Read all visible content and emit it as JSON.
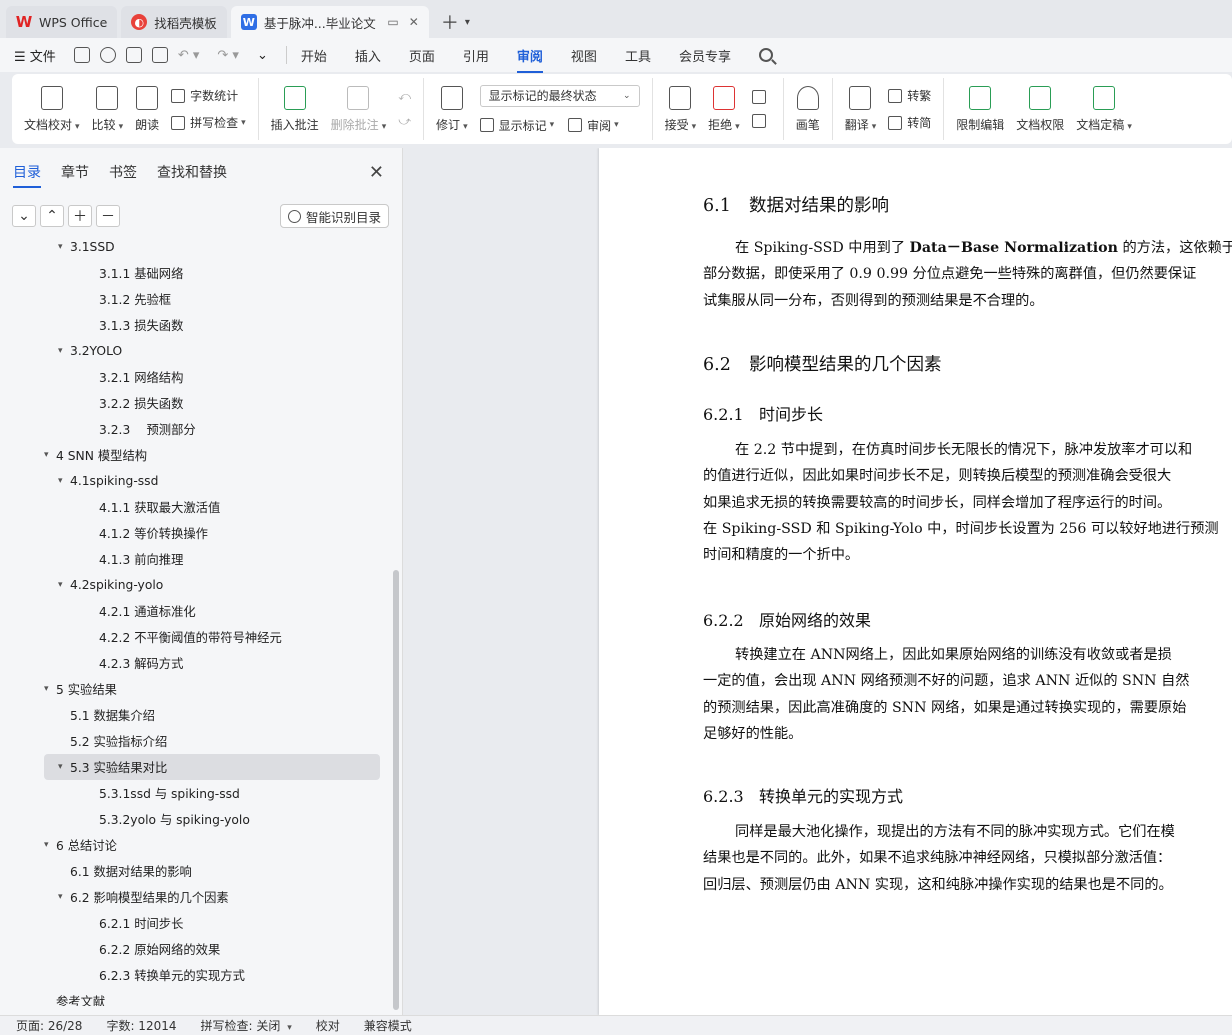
{
  "tabs": [
    {
      "label": "WPS Office",
      "icon": "wps-logo-icon"
    },
    {
      "label": "找稻壳模板",
      "icon": "daoke-logo-icon"
    },
    {
      "label": "基于脉冲...毕业论文",
      "icon": "writer-logo-icon",
      "active": true
    }
  ],
  "menu": {
    "file": "文件",
    "tabs": [
      "开始",
      "插入",
      "页面",
      "引用",
      "审阅",
      "视图",
      "工具",
      "会员专享"
    ],
    "selected": "审阅"
  },
  "ribbon": {
    "doc_check": "文档校对",
    "compare": "比较",
    "read_aloud": "朗读",
    "word_count": "字数统计",
    "spell_check": "拼写检查",
    "insert_comment": "插入批注",
    "delete_comment": "删除批注",
    "track_changes": "修订",
    "markup_state": "显示标记的最终状态",
    "show_markup": "显示标记",
    "review": "审阅",
    "accept": "接受",
    "reject": "拒绝",
    "pen": "画笔",
    "translate": "翻译",
    "to_traditional": "转繁",
    "to_simplified": "转简",
    "restrict_edit": "限制编辑",
    "doc_permission": "文档权限",
    "doc_finalize": "文档定稿"
  },
  "sidebar": {
    "tabs": [
      "目录",
      "章节",
      "书签",
      "查找和替换"
    ],
    "active_tab": "目录",
    "smart_toc": "智能识别目录",
    "toc": [
      {
        "label": "3.1SSD",
        "level": 1,
        "arrow": "down"
      },
      {
        "label": "3.1.1 基础网络",
        "level": 2
      },
      {
        "label": "3.1.2 先验框",
        "level": 2
      },
      {
        "label": "3.1.3 损失函数",
        "level": 2
      },
      {
        "label": "3.2YOLO",
        "level": 1,
        "arrow": "down"
      },
      {
        "label": "3.2.1 网络结构",
        "level": 2
      },
      {
        "label": "3.2.2 损失函数",
        "level": 2
      },
      {
        "label": "3.2.3　 预测部分",
        "level": 2
      },
      {
        "label": "4 SNN 模型结构",
        "level": 0,
        "arrow": "down"
      },
      {
        "label": "4.1spiking-ssd",
        "level": 1,
        "arrow": "down"
      },
      {
        "label": "4.1.1 获取最大激活值",
        "level": 2
      },
      {
        "label": "4.1.2 等价转换操作",
        "level": 2
      },
      {
        "label": "4.1.3 前向推理",
        "level": 2
      },
      {
        "label": "4.2spiking-yolo",
        "level": 1,
        "arrow": "down"
      },
      {
        "label": "4.2.1 通道标准化",
        "level": 2
      },
      {
        "label": "4.2.2 不平衡阈值的带符号神经元",
        "level": 2
      },
      {
        "label": "4.2.3 解码方式",
        "level": 2
      },
      {
        "label": "5 实验结果",
        "level": 0,
        "arrow": "down"
      },
      {
        "label": "5.1 数据集介绍",
        "level": 1
      },
      {
        "label": "5.2 实验指标介绍",
        "level": 1
      },
      {
        "label": "5.3 实验结果对比",
        "level": 1,
        "arrow": "down",
        "selected": true
      },
      {
        "label": "5.3.1ssd 与 spiking-ssd",
        "level": 2
      },
      {
        "label": "5.3.2yolo 与 spiking-yolo",
        "level": 2
      },
      {
        "label": "6 总结讨论",
        "level": 0,
        "arrow": "down"
      },
      {
        "label": "6.1 数据对结果的影响",
        "level": 1
      },
      {
        "label": "6.2 影响模型结果的几个因素",
        "level": 1,
        "arrow": "down"
      },
      {
        "label": "6.2.1 时间步长",
        "level": 2
      },
      {
        "label": "6.2.2 原始网络的效果",
        "level": 2
      },
      {
        "label": "6.2.3 转换单元的实现方式",
        "level": 2
      },
      {
        "label": "参考文献",
        "level": 0
      }
    ]
  },
  "document": {
    "h_6_1": {
      "num": "6.1",
      "title": "数据对结果的影响"
    },
    "p1": [
      "在 Spiking-SSD 中用到了",
      "Data－Base Normalization",
      "的方法，这依赖于",
      "部分数据，即使采用了 0.9 0.99 分位点避免一些特殊的离群值，但仍然要保证",
      "试集服从同一分布，否则得到的预测结果是不合理的。"
    ],
    "h_6_2": {
      "num": "6.2",
      "title": "影响模型结果的几个因素"
    },
    "h_6_2_1": {
      "num": "6.2.1",
      "title": "时间步长"
    },
    "p2": [
      "在 2.2 节中提到，在仿真时间步长无限长的情况下，脉冲发放率才可以和",
      "的值进行近似，因此如果时间步长不足，则转换后模型的预测准确会受很大",
      "如果追求无损的转换需要较高的时间步长，同样会增加了程序运行的时间。",
      "在 Spiking-SSD 和 Spiking-Yolo 中，时间步长设置为 256 可以较好地进行预测",
      "时间和精度的一个折中。"
    ],
    "h_6_2_2": {
      "num": "6.2.2",
      "title": "原始网络的效果"
    },
    "p3": [
      "转换建立在  ANN网络上，因此如果原始网络的训练没有收敛或者是损",
      "一定的值，会出现 ANN 网络预测不好的问题，追求 ANN 近似的 SNN 自然",
      "的预测结果，因此高准确度的 SNN 网络，如果是通过转换实现的，需要原始",
      "足够好的性能。"
    ],
    "h_6_2_3": {
      "num": "6.2.3",
      "title": "转换单元的实现方式"
    },
    "p4": [
      "同样是最大池化操作，现提出的方法有不同的脉冲实现方式。它们在模",
      "结果也是不同的。此外，如果不追求纯脉冲神经网络，只模拟部分激活值：",
      "回归层、预测层仍由 ANN 实现，这和纯脉冲操作实现的结果也是不同的。"
    ]
  },
  "status": {
    "page": "页面: 26/28",
    "words": "字数: 12014",
    "spell": "拼写检查: 关闭",
    "proof": "校对",
    "compat": "兼容模式"
  }
}
